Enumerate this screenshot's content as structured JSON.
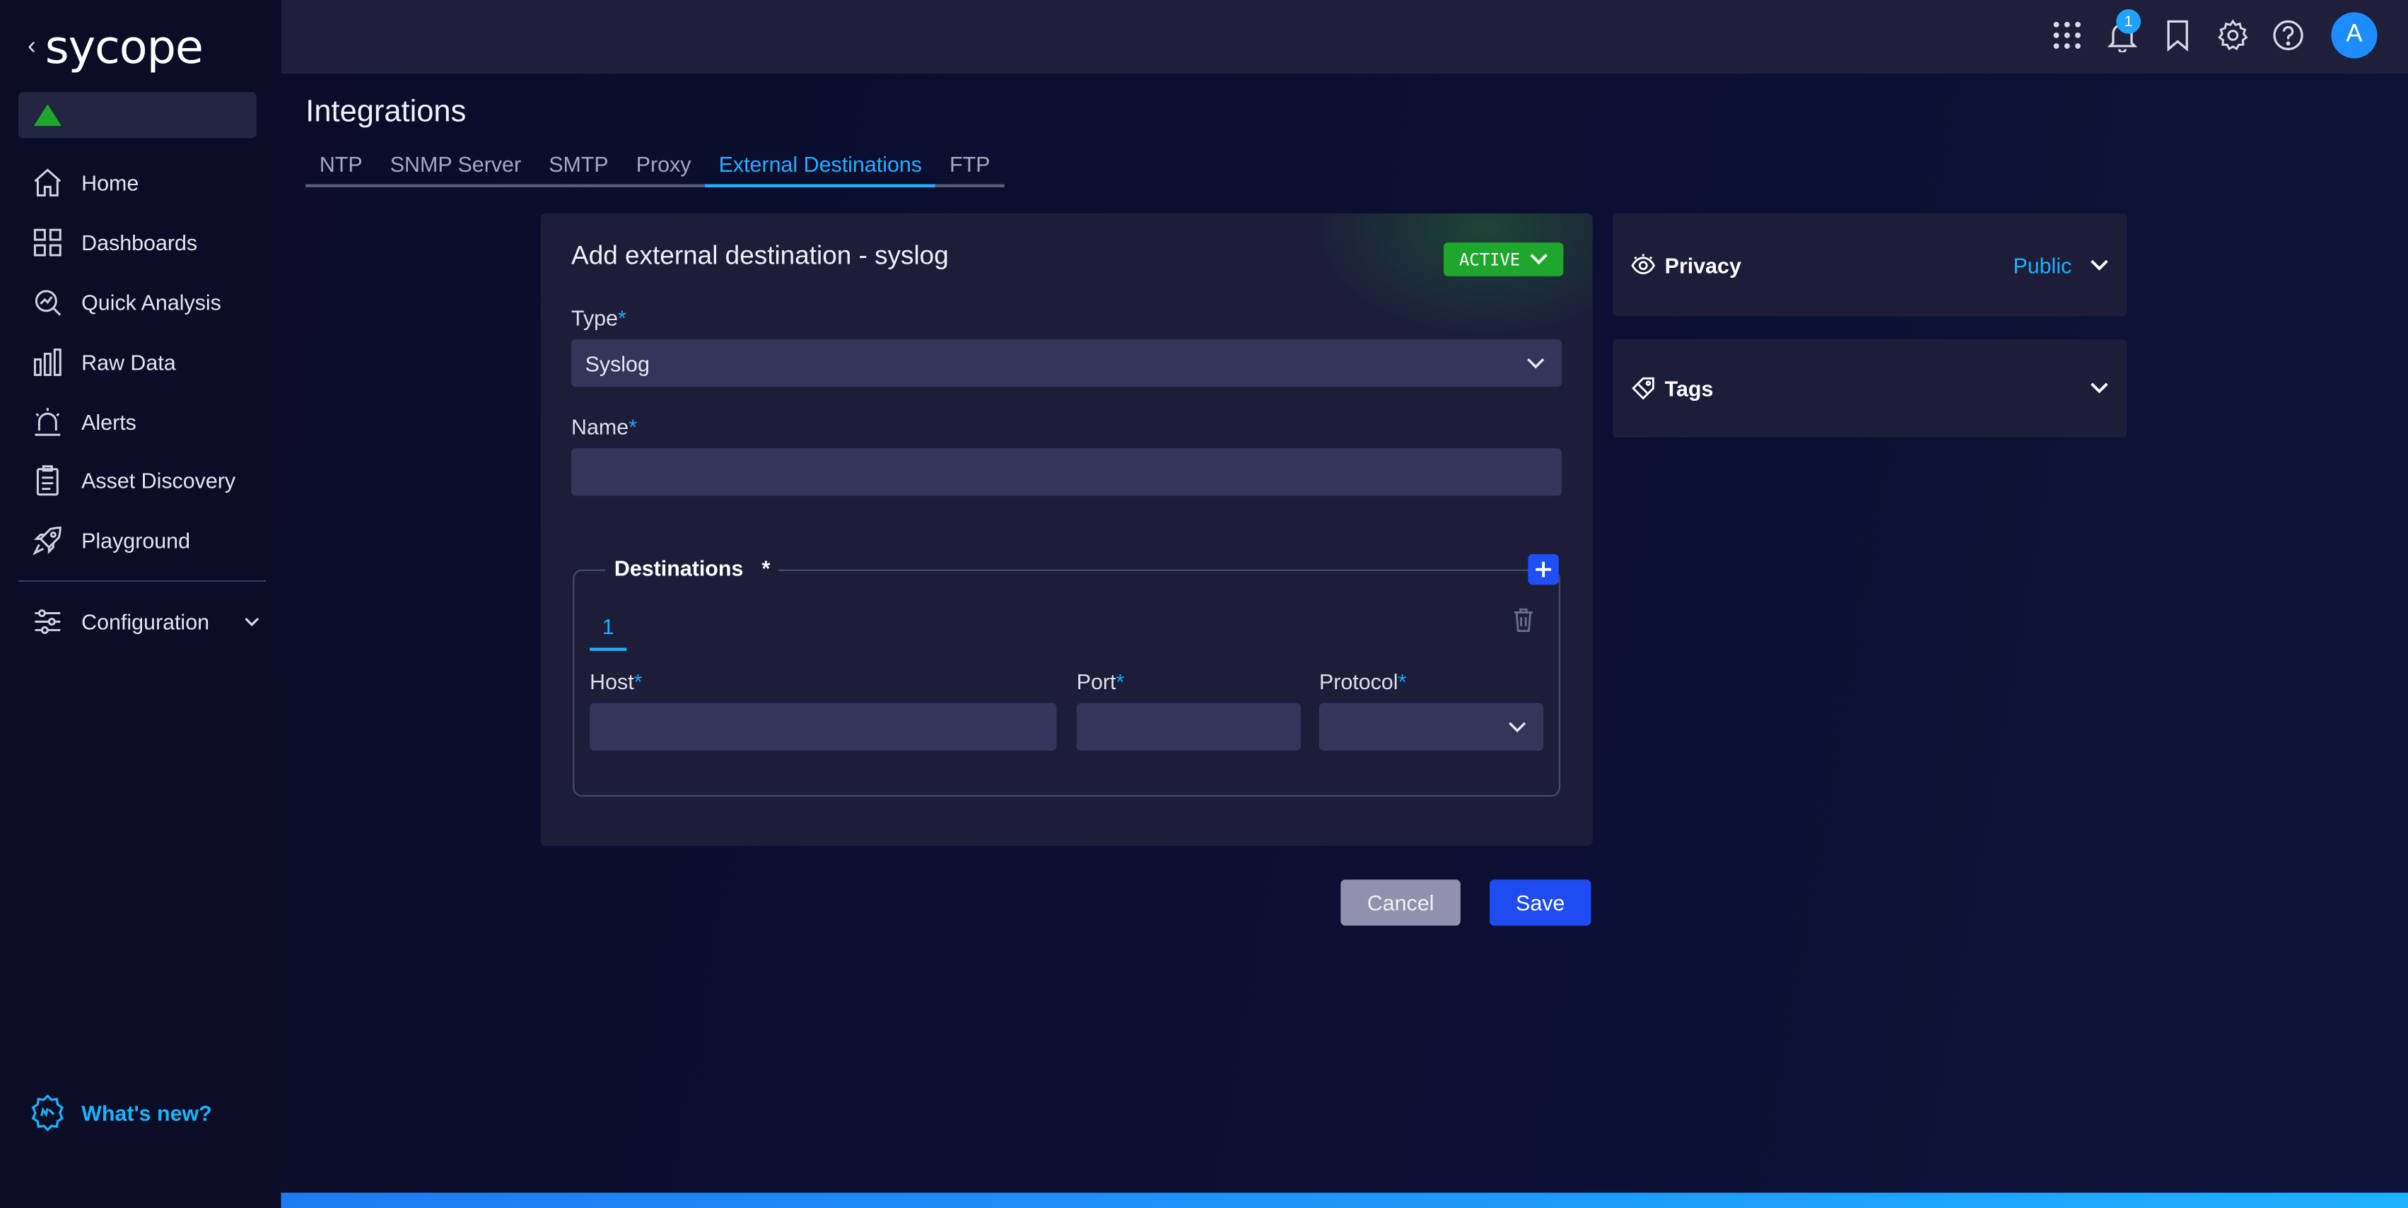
{
  "app": {
    "logo_text": "sycope",
    "back_glyph": "‹"
  },
  "sidebar": {
    "items": [
      {
        "label": "Home",
        "icon": "home-icon"
      },
      {
        "label": "Dashboards",
        "icon": "dashboards-icon"
      },
      {
        "label": "Quick Analysis",
        "icon": "quick-analysis-icon"
      },
      {
        "label": "Raw Data",
        "icon": "raw-data-icon"
      },
      {
        "label": "Alerts",
        "icon": "alerts-icon"
      },
      {
        "label": "Asset Discovery",
        "icon": "asset-discovery-icon"
      },
      {
        "label": "Playground",
        "icon": "playground-icon"
      }
    ],
    "configuration_label": "Configuration",
    "whats_new_label": "What's new?"
  },
  "topbar": {
    "notification_count": "1",
    "avatar_initial": "A"
  },
  "page": {
    "title": "Integrations",
    "tabs": [
      "NTP",
      "SNMP Server",
      "SMTP",
      "Proxy",
      "External Destinations",
      "FTP"
    ],
    "active_tab": "External Destinations"
  },
  "form": {
    "title": "Add external destination - syslog",
    "status": "ACTIVE",
    "type_label": "Type",
    "type_value": "Syslog",
    "name_label": "Name",
    "name_value": "",
    "required_marker": "*",
    "destinations_label": "Destinations",
    "destination_tab": "1",
    "host_label": "Host",
    "port_label": "Port",
    "protocol_label": "Protocol",
    "host_value": "",
    "port_value": "",
    "protocol_value": "",
    "cancel_label": "Cancel",
    "save_label": "Save"
  },
  "side": {
    "privacy_label": "Privacy",
    "privacy_value": "Public",
    "tags_label": "Tags"
  },
  "colors": {
    "accent": "#1fb0ff",
    "active_green": "#1fa72d",
    "primary_button": "#1e4cf2"
  }
}
